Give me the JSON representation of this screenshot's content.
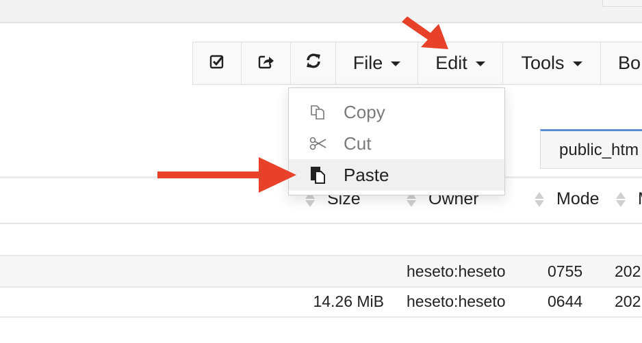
{
  "toolbar": {
    "buttons": [
      {
        "name": "select-all-button",
        "icon": "check-square-icon"
      },
      {
        "name": "share-button",
        "icon": "share-icon"
      },
      {
        "name": "refresh-button",
        "icon": "refresh-icon"
      }
    ],
    "menus": [
      {
        "label": "File"
      },
      {
        "label": "Edit"
      },
      {
        "label": "Tools"
      },
      {
        "label": "Bo"
      }
    ]
  },
  "edit_menu": {
    "items": [
      {
        "label": "Copy",
        "icon": "copy-icon",
        "state": "disabled"
      },
      {
        "label": "Cut",
        "icon": "scissors-icon",
        "state": "disabled"
      },
      {
        "label": "Paste",
        "icon": "paste-icon",
        "state": "hover"
      }
    ]
  },
  "path": {
    "value": "public_htm"
  },
  "table": {
    "columns": [
      "Size",
      "Owner",
      "Mode",
      "M"
    ],
    "rows": [
      {
        "size": "",
        "owner": "heseto:heseto",
        "mode": "0755",
        "modified": "202"
      },
      {
        "size": "14.26 MiB",
        "owner": "heseto:heseto",
        "mode": "0644",
        "modified": "202"
      }
    ]
  },
  "annotations": {
    "arrow_color": "#e8412a"
  }
}
